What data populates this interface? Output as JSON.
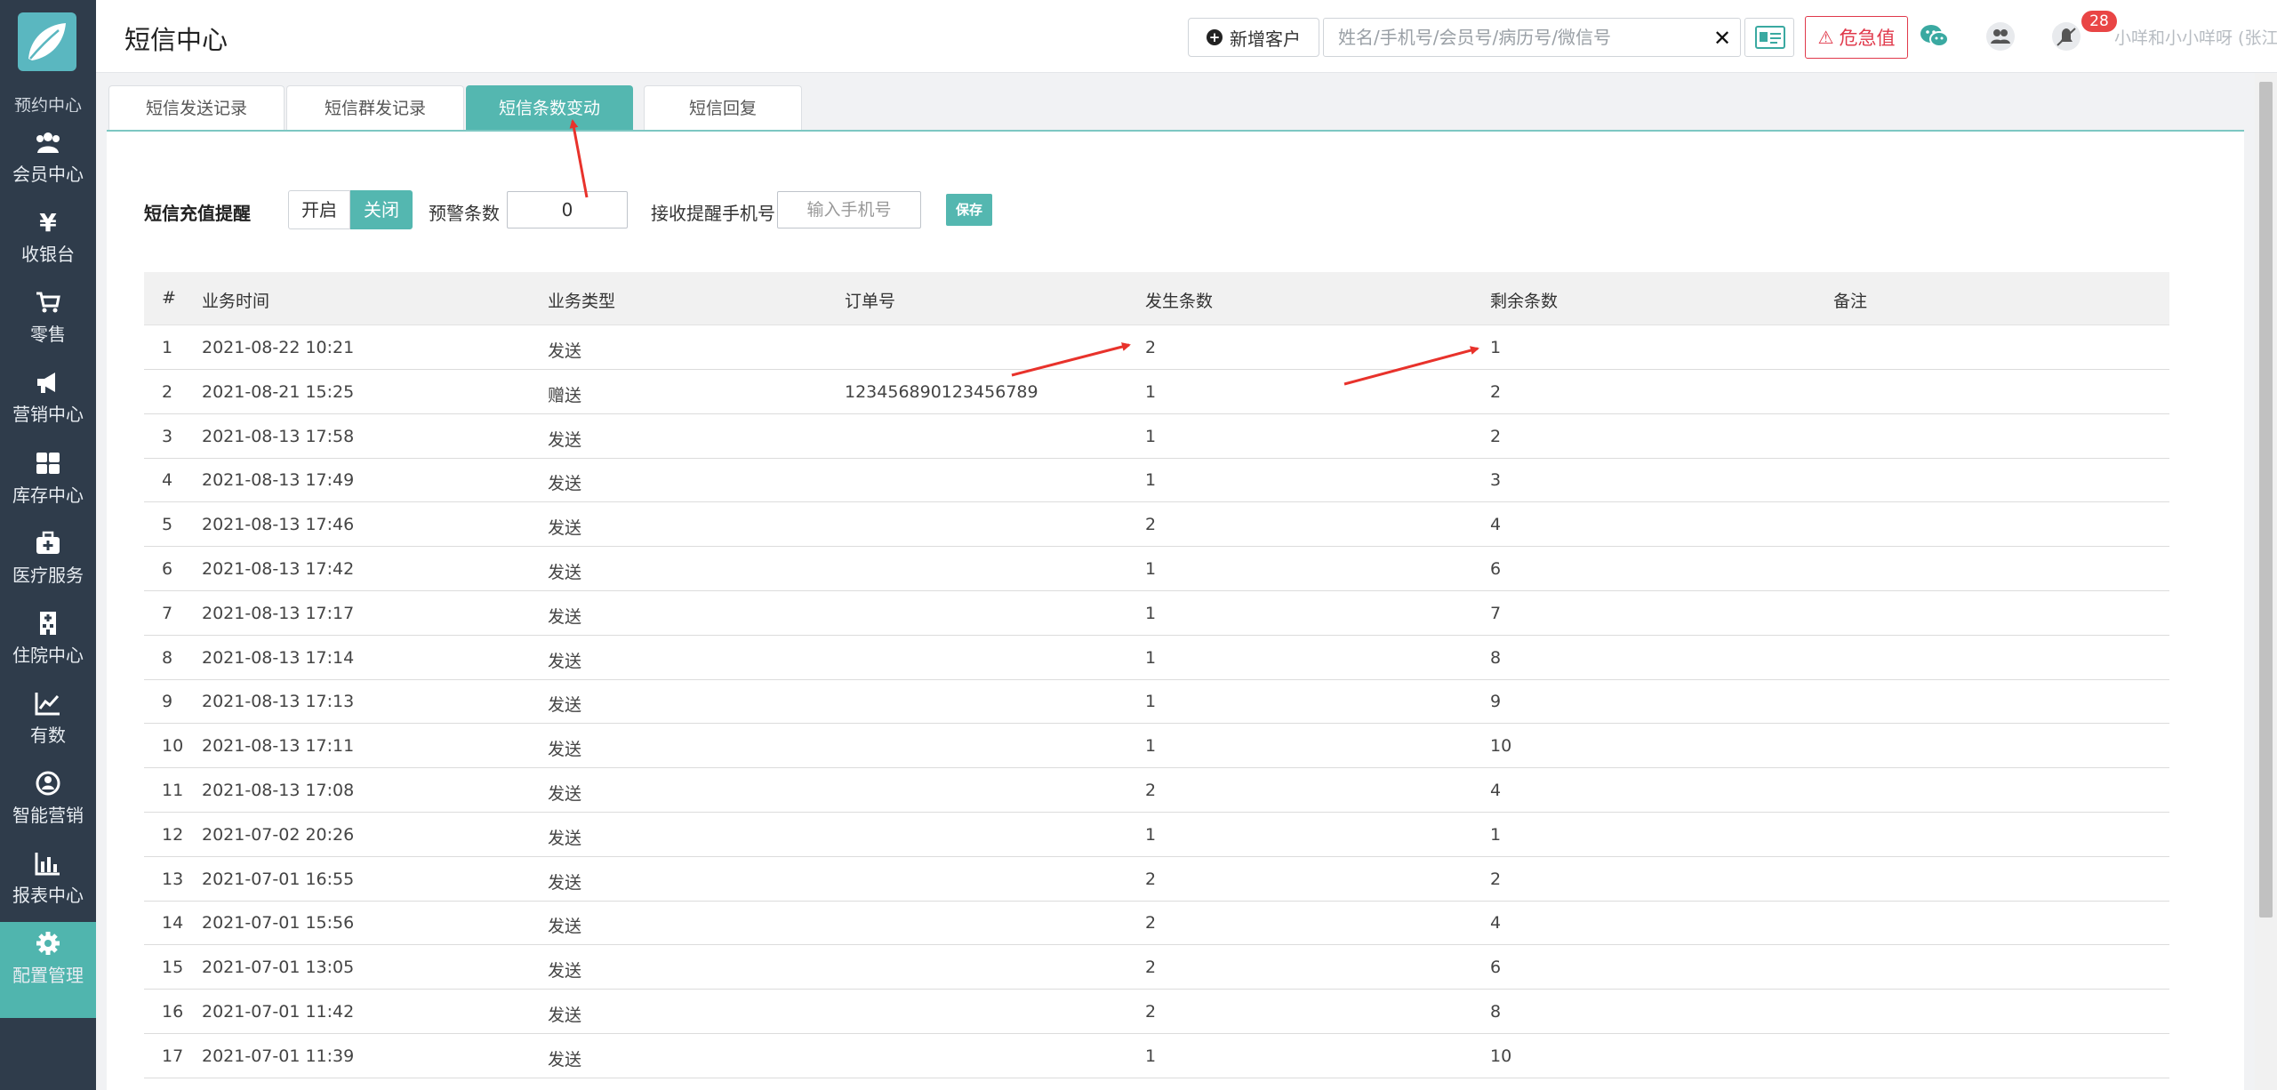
{
  "sidebar": {
    "partial_item": "预约中心",
    "items": [
      {
        "label": "会员中心",
        "icon": "users-icon"
      },
      {
        "label": "收银台",
        "icon": "yen-icon"
      },
      {
        "label": "零售",
        "icon": "cart-icon"
      },
      {
        "label": "营销中心",
        "icon": "megaphone-icon"
      },
      {
        "label": "库存中心",
        "icon": "grid-icon"
      },
      {
        "label": "医疗服务",
        "icon": "medkit-icon"
      },
      {
        "label": "住院中心",
        "icon": "hospital-icon"
      },
      {
        "label": "有数",
        "icon": "trend-icon"
      },
      {
        "label": "智能营销",
        "icon": "smart-icon"
      },
      {
        "label": "报表中心",
        "icon": "bar-chart-icon"
      },
      {
        "label": "配置管理",
        "icon": "gear-icon",
        "active": true
      }
    ]
  },
  "header": {
    "title": "短信中心",
    "new_customer": "新增客户",
    "search_placeholder": "姓名/手机号/会员号/病历号/微信号",
    "clear": "✕",
    "urgent": "危急值",
    "badge_count": "28",
    "user": "小咩和小小咩呀 (张江门诊部)"
  },
  "tabs": [
    {
      "label": "短信发送记录"
    },
    {
      "label": "短信群发记录"
    },
    {
      "label": "短信条数变动",
      "active": true
    },
    {
      "label": "短信回复"
    }
  ],
  "reminder": {
    "label": "短信充值提醒",
    "on": "开启",
    "off": "关闭",
    "warn_label": "预警条数",
    "warn_value": "0",
    "phone_label": "接收提醒手机号",
    "phone_placeholder": "输入手机号",
    "save": "保存"
  },
  "table": {
    "headers": [
      "#",
      "业务时间",
      "业务类型",
      "订单号",
      "发生条数",
      "剩余条数",
      "备注"
    ],
    "rows": [
      [
        "1",
        "2021-08-22 10:21",
        "发送",
        "",
        "2",
        "1",
        ""
      ],
      [
        "2",
        "2021-08-21 15:25",
        "赠送",
        "123456890123456789",
        "1",
        "2",
        ""
      ],
      [
        "3",
        "2021-08-13 17:58",
        "发送",
        "",
        "1",
        "2",
        ""
      ],
      [
        "4",
        "2021-08-13 17:49",
        "发送",
        "",
        "1",
        "3",
        ""
      ],
      [
        "5",
        "2021-08-13 17:46",
        "发送",
        "",
        "2",
        "4",
        ""
      ],
      [
        "6",
        "2021-08-13 17:42",
        "发送",
        "",
        "1",
        "6",
        ""
      ],
      [
        "7",
        "2021-08-13 17:17",
        "发送",
        "",
        "1",
        "7",
        ""
      ],
      [
        "8",
        "2021-08-13 17:14",
        "发送",
        "",
        "1",
        "8",
        ""
      ],
      [
        "9",
        "2021-08-13 17:13",
        "发送",
        "",
        "1",
        "9",
        ""
      ],
      [
        "10",
        "2021-08-13 17:11",
        "发送",
        "",
        "1",
        "10",
        ""
      ],
      [
        "11",
        "2021-08-13 17:08",
        "发送",
        "",
        "2",
        "4",
        ""
      ],
      [
        "12",
        "2021-07-02 20:26",
        "发送",
        "",
        "1",
        "1",
        ""
      ],
      [
        "13",
        "2021-07-01 16:55",
        "发送",
        "",
        "2",
        "2",
        ""
      ],
      [
        "14",
        "2021-07-01 15:56",
        "发送",
        "",
        "2",
        "4",
        ""
      ],
      [
        "15",
        "2021-07-01 13:05",
        "发送",
        "",
        "2",
        "6",
        ""
      ],
      [
        "16",
        "2021-07-01 11:42",
        "发送",
        "",
        "2",
        "8",
        ""
      ],
      [
        "17",
        "2021-07-01 11:39",
        "发送",
        "",
        "1",
        "10",
        ""
      ]
    ]
  },
  "colors": {
    "sidebar": "#2f3c4b",
    "accent": "#54b7b0",
    "danger": "#e0394b",
    "arrow": "#e8322b"
  }
}
